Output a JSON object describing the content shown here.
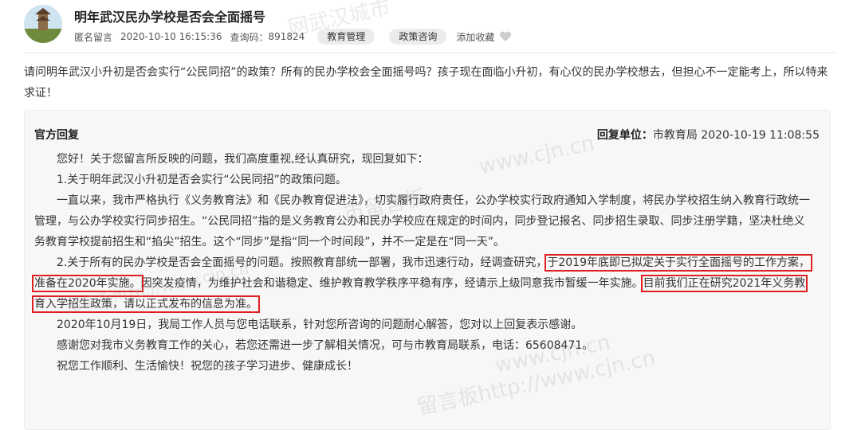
{
  "post": {
    "title": "明年武汉民办学校是否会全面摇号",
    "author": "匿名留言",
    "date": "2020-10-10 16:15:36",
    "query_code_label": "查询码：",
    "query_code": "891824",
    "tags": [
      "教育管理",
      "政策咨询"
    ],
    "favorite_label": "添加收藏",
    "question": "请问明年武汉小升初是否会实行“公民同招”的政策？所有的民办学校会全面摇号吗？孩子现在面临小升初，有心仪的民办学校想去，但担心不一定能考上，所以特来求证！"
  },
  "reply": {
    "label": "官方回复",
    "unit_label": "回复单位：",
    "unit": "市教育局",
    "date": "2020-10-19 11:08:55",
    "p1": "您好！关于您留言所反映的问题，我们高度重视,经认真研究，现回复如下：",
    "p2": "1.关于明年武汉小升初是否会实行“公民同招”的政策问题。",
    "p3": "一直以来，我市严格执行《义务教育法》和《民办教育促进法》，切实履行政府责任，公办学校实行政府通知入学制度，将民办学校招生纳入教育行政统一管理，与公办学校实行同步招生。“公民同招”指的是义务教育公办和民办学校应在规定的时间内，同步登记报名、同步招生录取、同步注册学籍，坚决杜绝义务教育学校提前招生和“掐尖”招生。这个“同步”是指“同一个时间段”，并不一定是在“同一天”。",
    "p4_a": "2.关于所有的民办学校是否会全面摇号的问题。按照教育部统一部署，我市迅速行动，经调查研究，",
    "p4_hl1": "于2019年底即已拟定关于实行全面摇号的工作方案，准备在2020年实施。",
    "p4_b": "因突发疫情，为维护社会和谐稳定、维护教育教学秩序平稳有序，经请示上级同意我市暂缓一年实施。",
    "p4_hl2": "目前我们正在研究2021年义务教育入学招生政策，请以正式发布的信息为准。",
    "p5": "2020年10月19日，我局工作人员与您电话联系，针对您所咨询的问题耐心解答，您对以上回复表示感谢。",
    "p6": "感谢您对我市义务教育工作的关心，若您还需进一步了解相关情况，可与市教育局联系，电话：65608471。",
    "p7": "祝您工作顺利、生活愉快！祝您的孩子学习进步、健康成长！"
  },
  "watermarks": [
    "网武汉城市",
    "www.cjn.cn",
    "市留言板",
    "www.cjn.cn",
    "留言板http://www.cjn.cn",
    "留言板http://www.cjn.cn"
  ]
}
